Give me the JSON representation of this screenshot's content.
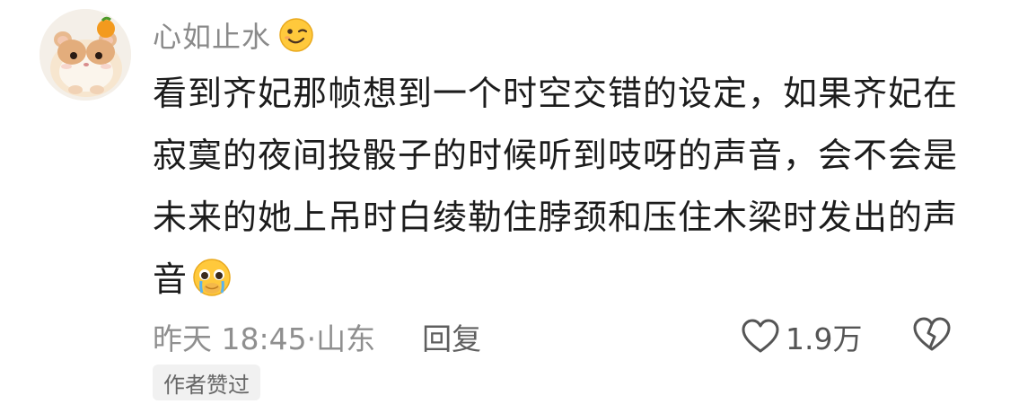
{
  "comment": {
    "username": "心如止水",
    "username_emoji": "winking-face",
    "text": "看到齐妃那帧想到一个时空交错的设定，如果齐妃在寂寞的夜间投骰子的时候听到吱呀的声音，会不会是未来的她上吊时白绫勒住脖颈和压住木梁时发出的声音",
    "text_end_emoji": "pleading-crying-face",
    "time": "昨天 18:45·",
    "location": "山东",
    "reply_label": "回复",
    "like_count": "1.9万",
    "author_badge": "作者赞过"
  },
  "colors": {
    "text": "#1c1c1c",
    "muted": "#8f8f8f",
    "badge_bg": "#f1f1f1"
  }
}
